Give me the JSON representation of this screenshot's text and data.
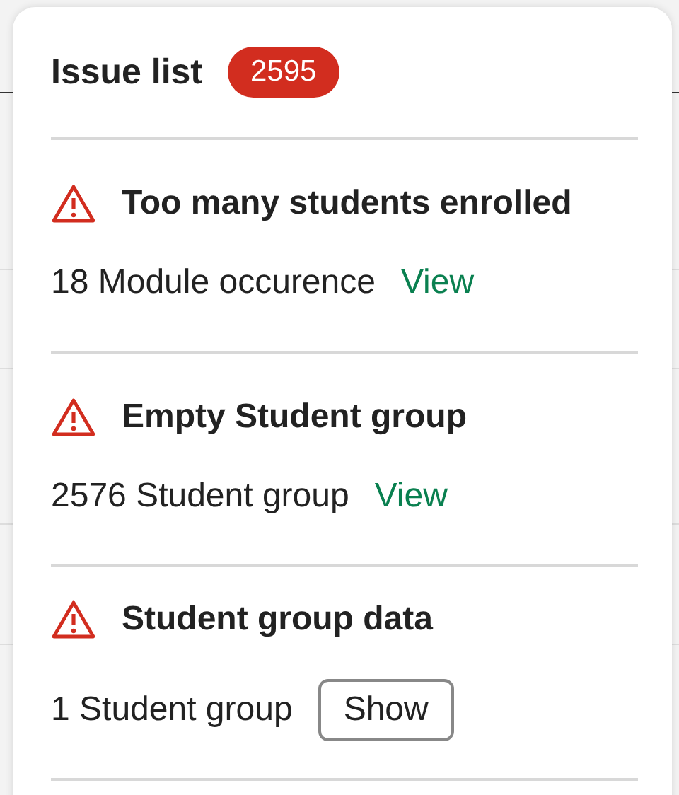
{
  "panel": {
    "title": "Issue list",
    "count": "2595"
  },
  "issues": [
    {
      "title": "Too many students enrolled",
      "detail": "18 Module occurence",
      "action": {
        "kind": "link",
        "label": "View"
      }
    },
    {
      "title": "Empty Student group",
      "detail": "2576 Student group",
      "action": {
        "kind": "link",
        "label": "View"
      }
    },
    {
      "title": "Student group data",
      "detail": "1 Student group",
      "action": {
        "kind": "button",
        "label": "Show"
      }
    }
  ]
}
